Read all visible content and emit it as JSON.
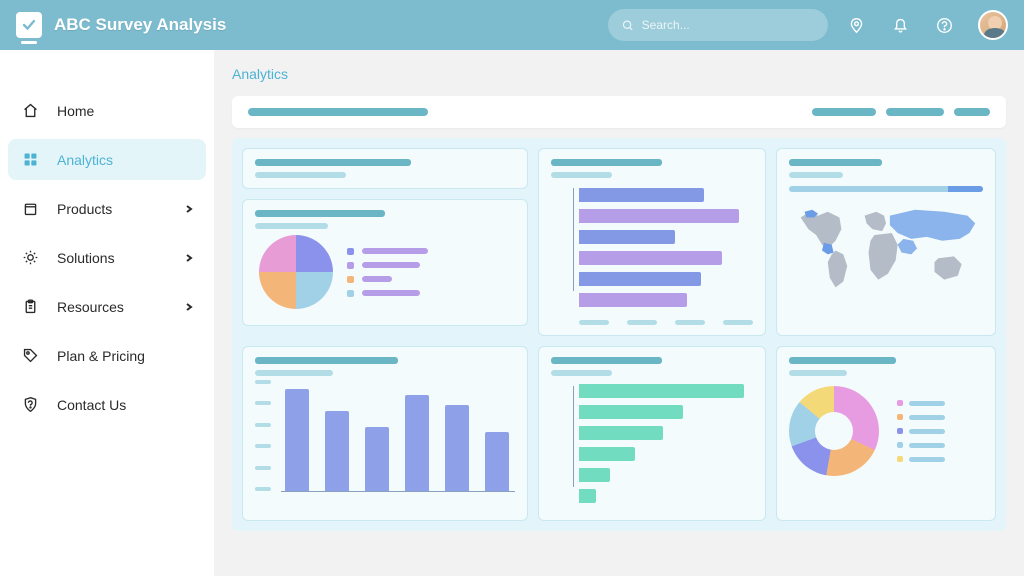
{
  "app": {
    "title": "ABC Survey Analysis"
  },
  "search": {
    "placeholder": "Search..."
  },
  "sidebar": {
    "items": [
      {
        "label": "Home",
        "chevron": false,
        "active": false
      },
      {
        "label": "Analytics",
        "chevron": false,
        "active": true
      },
      {
        "label": "Products",
        "chevron": true,
        "active": false
      },
      {
        "label": "Solutions",
        "chevron": true,
        "active": false
      },
      {
        "label": "Resources",
        "chevron": true,
        "active": false
      },
      {
        "label": "Plan & Pricing",
        "chevron": false,
        "active": false
      },
      {
        "label": "Contact Us",
        "chevron": false,
        "active": false
      }
    ]
  },
  "page": {
    "title": "Analytics"
  },
  "chart_data": [
    {
      "type": "pie",
      "position": "row1-col1-bottom",
      "slices": [
        {
          "color": "#8b92ec",
          "value": 25
        },
        {
          "color": "#a0d1e6",
          "value": 25
        },
        {
          "color": "#f4b678",
          "value": 25
        },
        {
          "color": "#e79cd6",
          "value": 25
        }
      ],
      "legend_colors": [
        "#8b92ec",
        "#b69de8",
        "#f4b678",
        "#a0d1e6"
      ]
    },
    {
      "type": "bar",
      "orientation": "horizontal",
      "position": "row1-col2",
      "series_alternating_colors": [
        "#8399e6",
        "#b69de8"
      ],
      "values": [
        72,
        92,
        55,
        82,
        70,
        62
      ]
    },
    {
      "type": "heatmap",
      "position": "row1-col3",
      "subtype": "world-map",
      "progress_bar_pct": 82
    },
    {
      "type": "bar",
      "orientation": "vertical",
      "position": "row2-col1",
      "values": [
        95,
        75,
        60,
        90,
        80,
        55
      ],
      "color": "#8ea0e8"
    },
    {
      "type": "bar",
      "orientation": "horizontal",
      "position": "row2-col2",
      "values": [
        95,
        60,
        48,
        32,
        18,
        10
      ],
      "color": "#72dcc0"
    },
    {
      "type": "pie",
      "subtype": "donut",
      "position": "row2-col3",
      "slices": [
        {
          "color": "#e79ce2",
          "value": 32
        },
        {
          "color": "#f4b678",
          "value": 21
        },
        {
          "color": "#8b92ec",
          "value": 17
        },
        {
          "color": "#a0d1e6",
          "value": 17
        },
        {
          "color": "#f4d978",
          "value": 14
        }
      ]
    }
  ]
}
